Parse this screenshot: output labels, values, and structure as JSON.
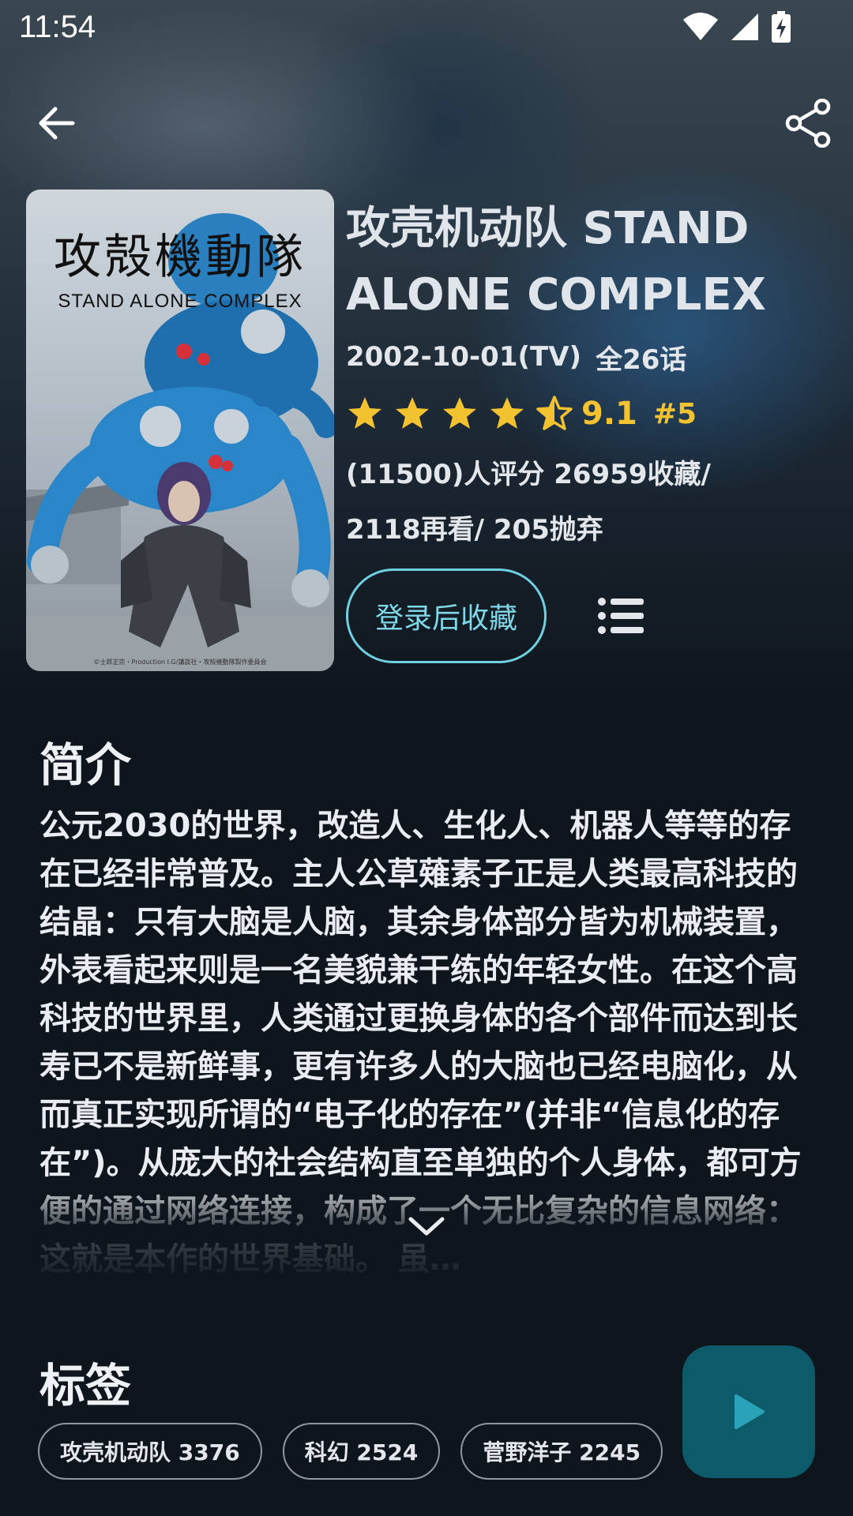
{
  "status_bar": {
    "time": "11:54"
  },
  "anime": {
    "title": "攻壳机动队 STAND ALONE COMPLEX",
    "air_date": "2002-10-01(TV)",
    "episodes": "全26话",
    "rating": {
      "stars": 4.5,
      "score": "9.1",
      "rank": "#5"
    },
    "stats_line1": "(11500)人评分  26959收藏/",
    "stats_line2": "2118再看/  205抛弃"
  },
  "poster": {
    "title_jp": "攻殻機動隊",
    "title_en": "STAND ALONE COMPLEX",
    "copyright": "©士郎正宗・Production I.G/講談社・攻殻機動隊製作委員会"
  },
  "actions": {
    "collect_label": "登录后收藏"
  },
  "synopsis": {
    "heading": "简介",
    "text": "公元2030的世界，改造人、生化人、机器人等等的存在已经非常普及。主人公草薙素子正是人类最高科技的结晶：只有大脑是人脑，其余身体部分皆为机械装置，外表看起来则是一名美貌兼干练的年轻女性。在这个高科技的世界里，人类通过更换身体的各个部件而达到长寿已不是新鲜事，更有许多人的大脑也已经电脑化，从而真正实现所谓的“电子化的存在”(并非“信息化的存在”)。从庞大的社会结构直至单独的个人身体，都可方便的通过网络连接，构成了一个无比复杂的信息网络：这就是本作的世界基础。 虽…"
  },
  "tags": {
    "heading": "标签",
    "items": [
      {
        "label": "攻壳机动队  3376"
      },
      {
        "label": "科幻  2524"
      },
      {
        "label": "菅野洋子  2245"
      }
    ]
  },
  "colors": {
    "accent": "#6fd0e2",
    "star": "#f2c231",
    "fab": "#0c5a6a",
    "background": "#0f151c"
  }
}
